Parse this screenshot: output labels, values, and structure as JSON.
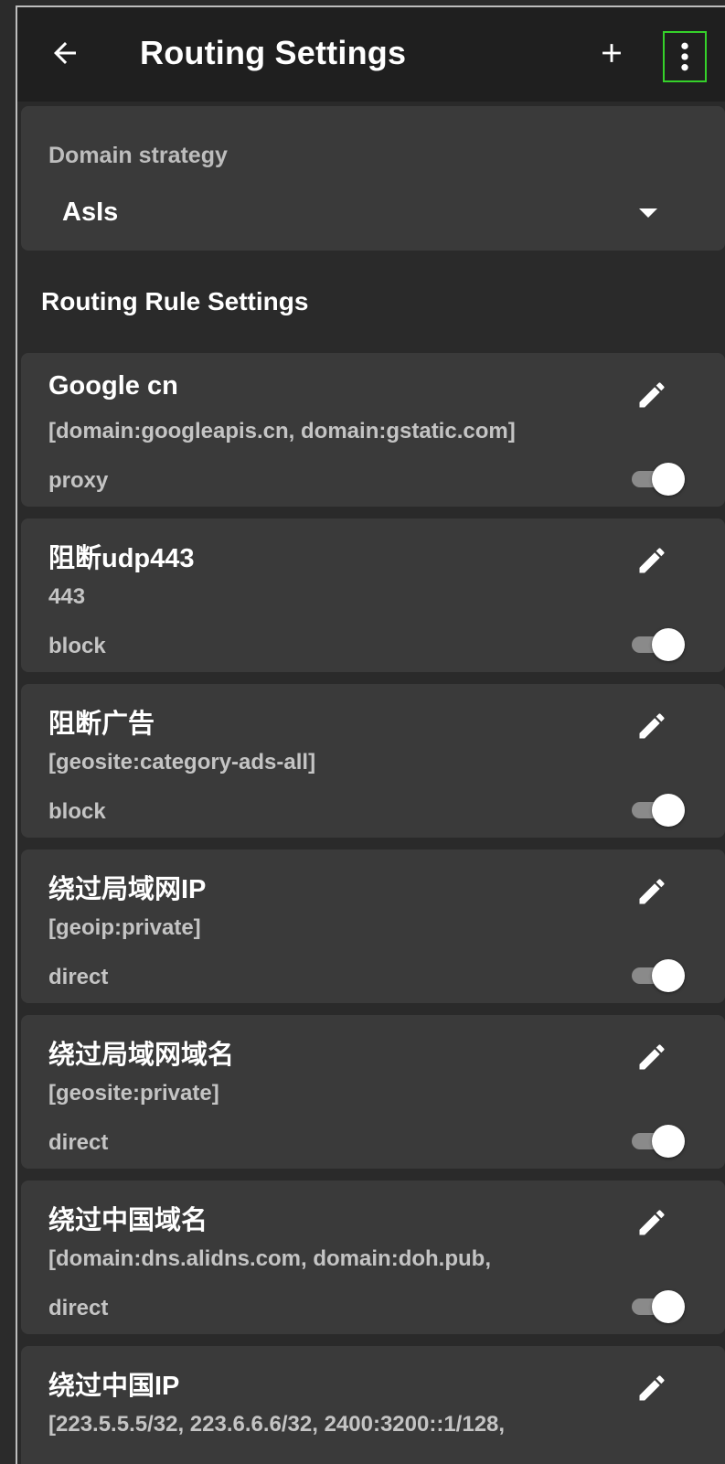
{
  "app_bar": {
    "title": "Routing Settings",
    "back_icon": "arrow-left-icon",
    "add_icon": "plus-icon",
    "more_icon": "more-vert-icon",
    "more_highlight_color": "#35d12a"
  },
  "domain_strategy": {
    "label": "Domain strategy",
    "value": "AsIs"
  },
  "rules_section": {
    "title": "Routing Rule Settings"
  },
  "rules": [
    {
      "title": "Google cn",
      "detail": "[domain:googleapis.cn, domain:gstatic.com]",
      "action": "proxy",
      "enabled": true
    },
    {
      "title": "阻断udp443",
      "detail": "443",
      "action": "block",
      "enabled": true
    },
    {
      "title": "阻断广告",
      "detail": "[geosite:category-ads-all]",
      "action": "block",
      "enabled": true
    },
    {
      "title": "绕过局域网IP",
      "detail": "[geoip:private]",
      "action": "direct",
      "enabled": true
    },
    {
      "title": "绕过局域网域名",
      "detail": "[geosite:private]",
      "action": "direct",
      "enabled": true
    },
    {
      "title": "绕过中国域名",
      "detail": "[domain:dns.alidns.com, domain:doh.pub,",
      "action": "direct",
      "enabled": true
    },
    {
      "title": "绕过中国IP",
      "detail": "[223.5.5.5/32, 223.6.6.6/32, 2400:3200::1/128,",
      "action": "",
      "enabled": true
    }
  ]
}
